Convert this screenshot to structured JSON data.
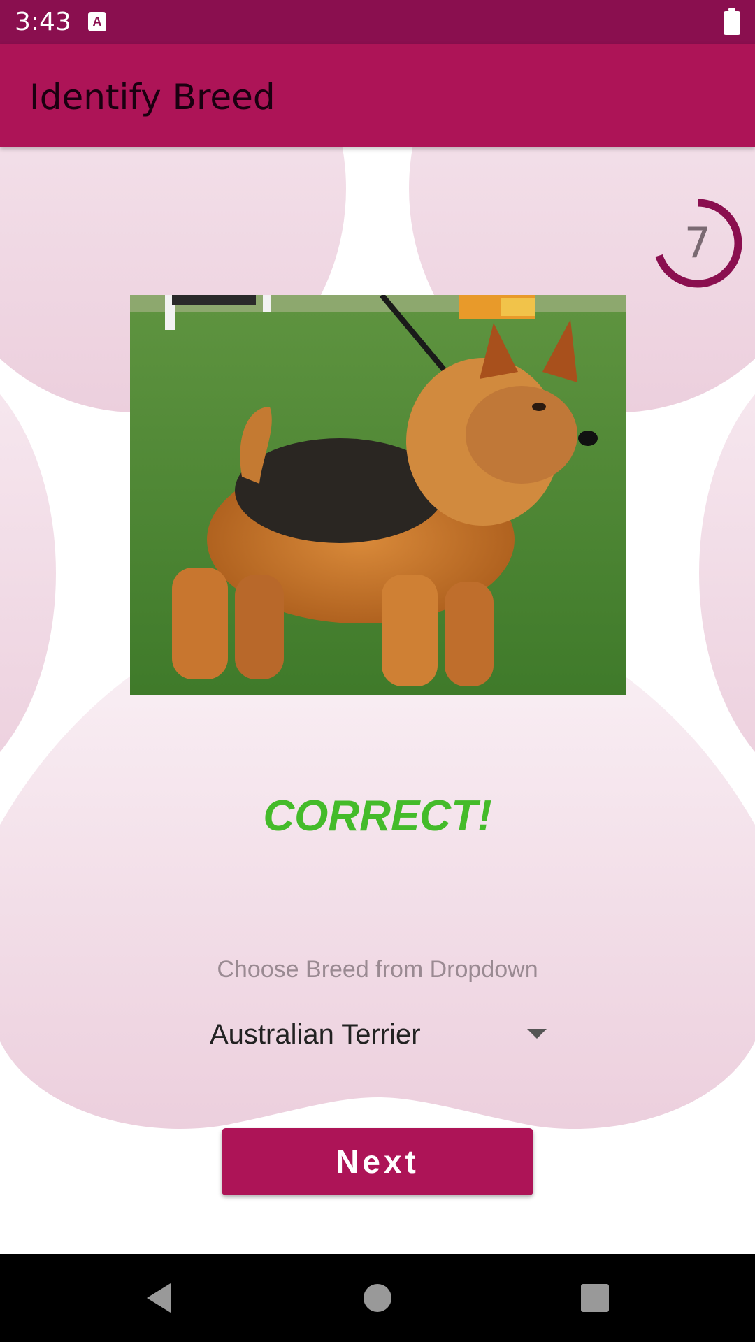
{
  "status_bar": {
    "time": "3:43",
    "notification_icon": "a-icon",
    "battery_icon": "battery-icon"
  },
  "app_bar": {
    "title": "Identify Breed"
  },
  "timer": {
    "value": "7",
    "progress": 0.7,
    "color": "#8a0f4f"
  },
  "question": {
    "image_icon": "dog-photo",
    "result": "CORRECT!",
    "result_color": "#44bb2a",
    "hint": "Choose Breed from Dropdown",
    "selected_breed": "Australian Terrier"
  },
  "actions": {
    "next_label": "Next"
  },
  "nav_bar": {
    "back_icon": "back-icon",
    "home_icon": "home-icon",
    "recents_icon": "recents-icon"
  },
  "colors": {
    "primary": "#ad1457",
    "primary_dark": "#8a0f4f",
    "paw_tint": "#f3dbe6"
  }
}
